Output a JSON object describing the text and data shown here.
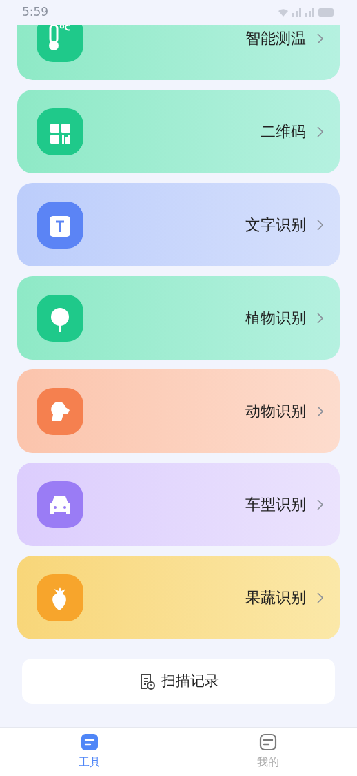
{
  "status_bar": {
    "time": "5:59"
  },
  "tools": [
    {
      "label": "智能测温",
      "color": "#1fc98a"
    },
    {
      "label": "二维码",
      "color": "#1fc98a"
    },
    {
      "label": "文字识别",
      "color": "#5b84f5"
    },
    {
      "label": "植物识别",
      "color": "#1fc98a"
    },
    {
      "label": "动物识别",
      "color": "#f5804f"
    },
    {
      "label": "车型识别",
      "color": "#9a7cf5"
    },
    {
      "label": "果蔬识别",
      "color": "#f7a52c"
    }
  ],
  "scan_record": {
    "label": "扫描记录"
  },
  "tabs": [
    {
      "label": "工具",
      "selected": true
    },
    {
      "label": "我的",
      "selected": false
    }
  ]
}
